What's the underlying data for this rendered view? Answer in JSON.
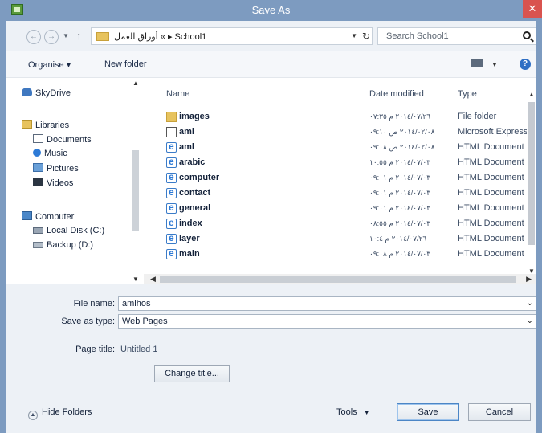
{
  "window": {
    "title": "Save As",
    "close_glyph": "✕",
    "accent": "#7d9bc0"
  },
  "address": {
    "back_glyph": "←",
    "forward_glyph": "→",
    "up_glyph": "↑",
    "path": "أوراق العمل « ▸ School1",
    "refresh_glyph": "↻",
    "search_placeholder": "Search School1"
  },
  "toolbar": {
    "organise": "Organise ▾",
    "new_folder": "New folder",
    "help_glyph": "?"
  },
  "nav": {
    "items": [
      {
        "label": "SkyDrive",
        "icon": "cloud-icon"
      },
      {
        "label": "Libraries",
        "icon": "libraries-icon"
      },
      {
        "label": "Documents",
        "icon": "documents-icon"
      },
      {
        "label": "Music",
        "icon": "music-icon"
      },
      {
        "label": "Pictures",
        "icon": "pictures-icon"
      },
      {
        "label": "Videos",
        "icon": "videos-icon"
      },
      {
        "label": "Computer",
        "icon": "computer-icon"
      },
      {
        "label": "Local Disk (C:)",
        "icon": "disk-icon"
      },
      {
        "label": "Backup (D:)",
        "icon": "drive-icon"
      }
    ]
  },
  "files": {
    "columns": {
      "name": "Name",
      "date": "Date modified",
      "type": "Type"
    },
    "rows": [
      {
        "name": "images",
        "date": "٢٠١٤/٠٧/٢٦ م ٠٧:٣٥",
        "type": "File folder",
        "icon": "folder"
      },
      {
        "name": "aml",
        "date": "٢٠١٤/٠٢/٠٨ ص ٠٩:١٠",
        "type": "Microsoft Express",
        "icon": "file"
      },
      {
        "name": "aml",
        "date": "٢٠١٤/٠٢/٠٨ ص ٠٩:٠٨",
        "type": "HTML Document",
        "icon": "html"
      },
      {
        "name": "arabic",
        "date": "٢٠١٤/٠٧/٠٣ م ١٠:٥٥",
        "type": "HTML Document",
        "icon": "html"
      },
      {
        "name": "computer",
        "date": "٢٠١٤/٠٧/٠٣ م ٠٩:٠١",
        "type": "HTML Document",
        "icon": "html"
      },
      {
        "name": "contact",
        "date": "٢٠١٤/٠٧/٠٣ م ٠٩:٠١",
        "type": "HTML Document",
        "icon": "html"
      },
      {
        "name": "general",
        "date": "٢٠١٤/٠٧/٠٣ م ٠٩:٠١",
        "type": "HTML Document",
        "icon": "html"
      },
      {
        "name": "index",
        "date": "٢٠١٤/٠٧/٠٣ م ٠٨:٥٥",
        "type": "HTML Document",
        "icon": "html"
      },
      {
        "name": "layer",
        "date": "٢٠١٤/٠٧/٢٦ م ١٠:٤",
        "type": "HTML Document",
        "icon": "html"
      },
      {
        "name": "main",
        "date": "٢٠١٤/٠٧/٠٣ م ٠٩:٠٨",
        "type": "HTML Document",
        "icon": "html"
      }
    ]
  },
  "form": {
    "filename_label": "File name:",
    "filename_value": "amlhos",
    "savetype_label": "Save as type:",
    "savetype_value": "Web Pages",
    "pagetitle_label": "Page title:",
    "pagetitle_value": "Untitled 1",
    "change_title": "Change title..."
  },
  "bottom": {
    "hide_folders": "Hide Folders",
    "tools": "Tools",
    "save": "Save",
    "cancel": "Cancel"
  }
}
